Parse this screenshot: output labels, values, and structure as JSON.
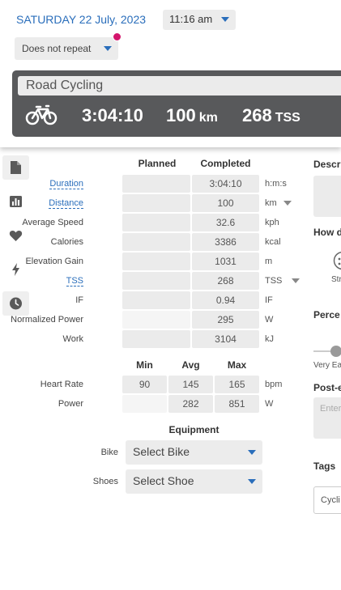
{
  "header": {
    "date": "SATURDAY 22 July, 2023",
    "time": "11:16 am",
    "repeat": "Does not repeat"
  },
  "workout": {
    "title": "Road Cycling",
    "icon": "bicycle-icon",
    "duration": "3:04:10",
    "distance_value": "100",
    "distance_unit": "km",
    "tss_value": "268",
    "tss_unit": "TSS"
  },
  "sidebar": {
    "items": [
      {
        "icon": "document-icon",
        "active": true
      },
      {
        "icon": "bar-chart-icon",
        "active": false
      },
      {
        "icon": "heart-icon",
        "active": false
      },
      {
        "icon": "lightning-icon",
        "active": false
      },
      {
        "icon": "clock-icon",
        "active": true
      }
    ]
  },
  "summary": {
    "headers": {
      "planned": "Planned",
      "completed": "Completed"
    },
    "rows": [
      {
        "label": "Duration",
        "planned": "",
        "completed": "3:04:10",
        "unit": "h:m:s"
      },
      {
        "label": "Distance",
        "planned": "",
        "completed": "100",
        "unit": "km"
      },
      {
        "label": "Average Speed",
        "planned": "",
        "completed": "32.6",
        "unit": "kph"
      },
      {
        "label": "Calories",
        "planned": "",
        "completed": "3386",
        "unit": "kcal"
      },
      {
        "label": "Elevation Gain",
        "planned": "",
        "completed": "1031",
        "unit": "m"
      },
      {
        "label": "TSS",
        "planned": "",
        "completed": "268",
        "unit": "TSS"
      },
      {
        "label": "IF",
        "planned": "",
        "completed": "0.94",
        "unit": "IF"
      },
      {
        "label": "Normalized Power",
        "planned": "",
        "completed": "295",
        "unit": "W"
      },
      {
        "label": "Work",
        "planned": "",
        "completed": "3104",
        "unit": "kJ"
      }
    ]
  },
  "minmax": {
    "headers": {
      "min": "Min",
      "avg": "Avg",
      "max": "Max"
    },
    "rows": [
      {
        "label": "Heart Rate",
        "min": "90",
        "avg": "145",
        "max": "165",
        "unit": "bpm"
      },
      {
        "label": "Power",
        "min": "",
        "avg": "282",
        "max": "851",
        "unit": "W"
      }
    ]
  },
  "equipment": {
    "title": "Equipment",
    "bike_label": "Bike",
    "bike_value": "Select Bike",
    "shoes_label": "Shoes",
    "shoes_value": "Select Shoe"
  },
  "right_panel": {
    "description_label": "Descr",
    "how_label": "How d",
    "strength_label": "Str",
    "perceived_label": "Perce",
    "very_easy_label": "Very Ea",
    "post_label": "Post-e",
    "post_placeholder": "Enter",
    "tags_label": "Tags",
    "tags_value": "Cycli"
  },
  "colors": {
    "accent": "#2a6ebb",
    "notification_dot": "#d4146c",
    "card_bg": "#58595b"
  }
}
